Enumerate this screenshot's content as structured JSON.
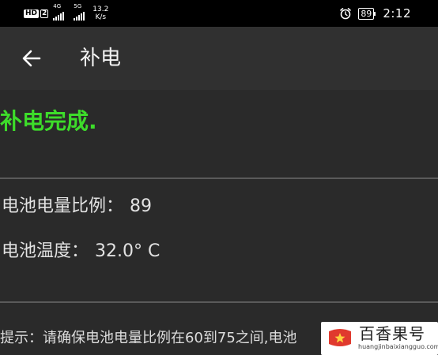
{
  "status_bar": {
    "hd_label": "HD",
    "sim_label": "2",
    "signal_1_network": "4G",
    "signal_2_network": "5G",
    "net_speed_value": "13.2",
    "net_speed_unit": "K/s",
    "alarm_icon": "alarm-clock-icon",
    "battery_level": "89",
    "clock": "2:12"
  },
  "app_bar": {
    "back_icon": "arrow-left-icon",
    "title": "补电"
  },
  "result": {
    "message": "补电完成.",
    "color": "#3ddc2a"
  },
  "info": {
    "battery_ratio_label": "电池电量比例：",
    "battery_ratio_value": "89",
    "battery_temp_label": "电池温度：",
    "battery_temp_value": "32.0° C"
  },
  "hint": {
    "text": "提示：请确保电池电量比例在60到75之间,电池"
  },
  "watermark": {
    "name": "百香果号",
    "url": "huangjinbaixiangguo.com"
  }
}
